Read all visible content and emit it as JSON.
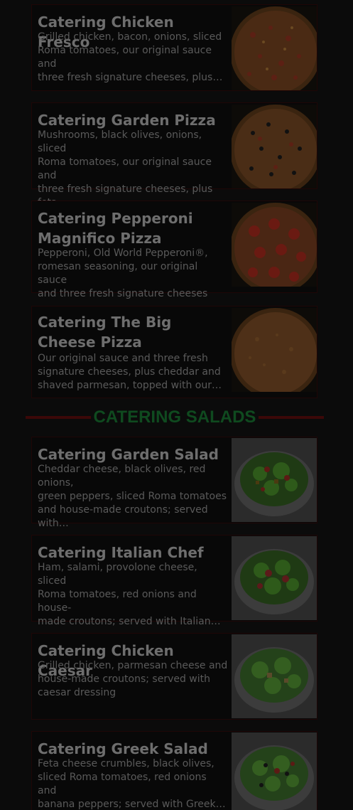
{
  "pizzas": [
    {
      "title": "Catering Chicken Fresco",
      "description": "Grilled chicken, bacon, onions, sliced\nRoma tomatoes, our original sauce and\nthree fresh signature cheeses, plus…",
      "image": "pizza-chicken-fresco"
    },
    {
      "title": "Catering Garden Pizza",
      "description": "Mushrooms, black olives, onions, sliced\nRoma tomatoes, our original sauce and\nthree fresh signature cheeses, plus feta",
      "image": "pizza-garden"
    },
    {
      "title": "Catering Pepperoni Magnifico Pizza",
      "description": "Pepperoni, Old World Pepperoni®,\nromesan seasoning, our original sauce\nand three fresh signature cheeses",
      "image": "pizza-pepperoni"
    },
    {
      "title": "Catering The Big Cheese Pizza",
      "description": "Our original sauce and three fresh\nsignature cheeses, plus cheddar and\nshaved parmesan, topped with our…",
      "image": "pizza-big-cheese"
    }
  ],
  "salads_heading": "CATERING SALADS",
  "salads": [
    {
      "title": "Catering Garden Salad",
      "description": "Cheddar cheese, black olives, red onions,\ngreen peppers, sliced Roma tomatoes\nand house-made croutons; served with…",
      "image": "salad-garden"
    },
    {
      "title": "Catering Italian Chef",
      "description": "Ham, salami, provolone cheese, sliced\nRoma tomatoes, red onions and house-\nmade croutons; served with Italian…",
      "image": "salad-italian-chef"
    },
    {
      "title": "Catering Chicken Caesar",
      "description": "Grilled chicken, parmesan cheese and\nhouse-made croutons; served with\ncaesar dressing",
      "image": "salad-chicken-caesar"
    },
    {
      "title": "Catering Greek Salad",
      "description": "Feta cheese crumbles, black olives,\nsliced Roma tomatoes, red onions and\nbanana peppers; served with Greek…",
      "image": "salad-greek"
    }
  ],
  "colors": {
    "background": "#0b0b0b",
    "heading_green": "#0f4a1f",
    "rule_red": "#3c0808",
    "title_grey": "#6e6e6e",
    "desc_grey": "#5a5a5a"
  }
}
